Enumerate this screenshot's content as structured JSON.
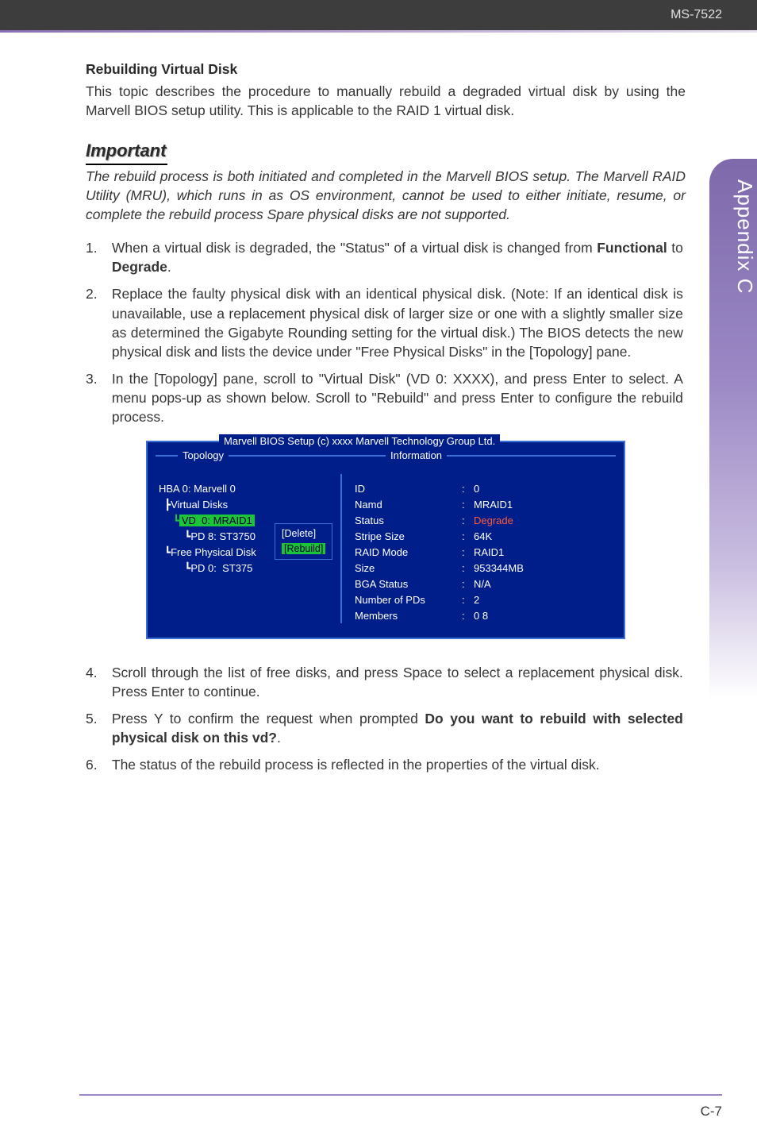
{
  "header": {
    "model": "MS-7522"
  },
  "sidetab": "Appendix C",
  "section_title": "Rebuilding Virtual Disk",
  "intro": "This topic describes the procedure to manually rebuild a degraded virtual disk by using the Marvell BIOS setup utility. This is applicable to the RAID 1 virtual disk.",
  "important_label": "Important",
  "important_text": "The rebuild process is both initiated and completed in the Marvell BIOS setup. The Marvell RAID Utility (MRU), which runs in as OS environment, cannot be used to either initiate, resume, or complete the rebuild process Spare physical disks are not supported.",
  "steps_a": [
    {
      "num": "1.",
      "pre": "When a virtual disk is degraded, the \"Status\" of a virtual disk is changed from ",
      "b1": "Functional",
      "mid": " to ",
      "b2": "Degrade",
      "post": "."
    },
    {
      "num": "2.",
      "pre": "Replace the faulty physical disk with an identical physical disk. (Note: If an identical disk is unavailable, use a replacement physical disk of larger size or one with a slightly smaller size as determined the Gigabyte Rounding setting for the virtual disk.) The BIOS detects the new physical disk and lists the device under \"Free Physical Disks\" in the [Topology] pane."
    },
    {
      "num": "3.",
      "pre": "In the [Topology] pane, scroll to \"Virtual Disk\" (VD 0: XXXX), and press Enter to select. A menu pops-up as shown below. Scroll to \"Rebuild\" and press Enter to configure the rebuild process."
    }
  ],
  "bios": {
    "title": "Marvell BIOS Setup (c) xxxx Marvell Technology Group Ltd.",
    "left_label": "Topology",
    "right_label": "Information",
    "tree": {
      "hba": "HBA 0: Marvell 0",
      "vdisks": "Virtual Disks",
      "vd0": "VD  0: MRAID1",
      "pd8": "PD 8: ST3750",
      "freepd": "Free Physical Disk",
      "pd0": "PD 0:  ST375"
    },
    "menu": {
      "delete": "[Delete]",
      "rebuild": "[Rebuild]"
    },
    "info": [
      {
        "k": "ID",
        "v": "0"
      },
      {
        "k": "Namd",
        "v": "MRAID1"
      },
      {
        "k": "Status",
        "v": "Degrade",
        "deg": true
      },
      {
        "k": "Stripe  Size",
        "v": "64K"
      },
      {
        "k": "RAID  Mode",
        "v": "RAID1"
      },
      {
        "k": "Size",
        "v": "953344MB"
      },
      {
        "k": "BGA  Status",
        "v": "N/A"
      },
      {
        "k": "Number  of  PDs",
        "v": "2"
      },
      {
        "k": "Members",
        "v": "0   8"
      }
    ]
  },
  "steps_b": [
    {
      "num": "4.",
      "pre": "Scroll through the list of free disks, and press Space to select a replacement physical disk. Press Enter to continue."
    },
    {
      "num": "5.",
      "pre": "Press Y to confirm the request when prompted ",
      "b1": "Do you want to rebuild with selected physical disk on this vd?",
      "post": "."
    },
    {
      "num": "6.",
      "pre": "The status of the rebuild process is reflected in the properties of the virtual disk."
    }
  ],
  "page_number": "C-7"
}
